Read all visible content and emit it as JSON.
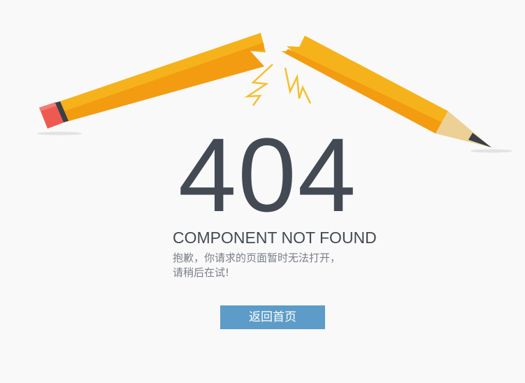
{
  "error": {
    "code": "404",
    "headline": "COMPONENT NOT FOUND",
    "message_line_1": "抱歉，你请求的页面暂时无法打开，",
    "message_line_2": "请稍后在试!"
  },
  "actions": {
    "back_home_label": "返回首页"
  },
  "colors": {
    "background": "#f9f9f9",
    "text_dark": "#434a54",
    "text_muted": "#7a7f87",
    "button": "#5d9cc8",
    "pencil_body": "#f6b21a",
    "pencil_eraser": "#ee5a52",
    "pencil_wood": "#ecd096"
  },
  "illustration": {
    "icon": "broken-pencil-icon"
  }
}
